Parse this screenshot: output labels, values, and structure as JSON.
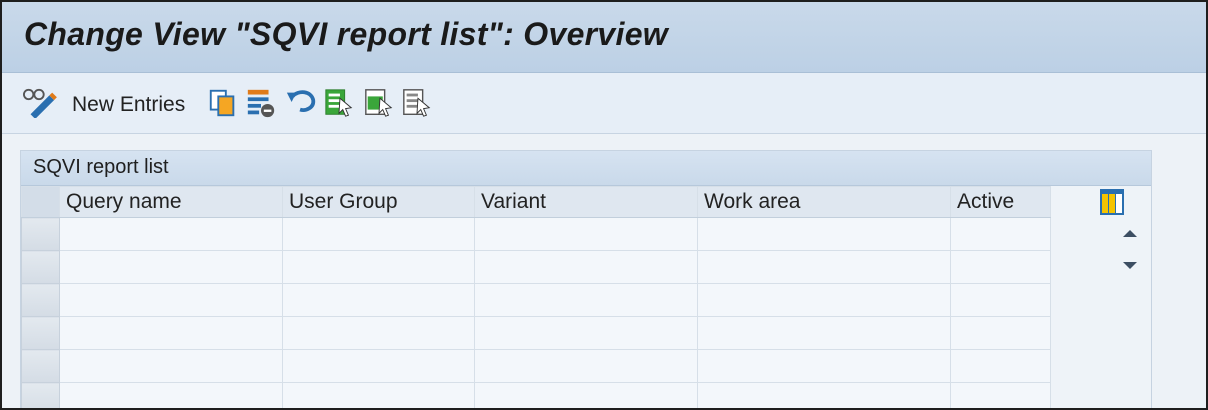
{
  "window": {
    "title": "Change View \"SQVI report list\": Overview"
  },
  "toolbar": {
    "new_entries_label": "New Entries",
    "icons": [
      "display-change-icon",
      "copy-icon",
      "delete-icon",
      "undo-icon",
      "select-all-icon",
      "select-block-icon",
      "deselect-all-icon"
    ]
  },
  "table": {
    "title": "SQVI report list",
    "columns": [
      "Query name",
      "User Group",
      "Variant",
      "Work area",
      "Active"
    ],
    "rows": [
      [
        "",
        "",
        "",
        "",
        ""
      ],
      [
        "",
        "",
        "",
        "",
        ""
      ],
      [
        "",
        "",
        "",
        "",
        ""
      ],
      [
        "",
        "",
        "",
        "",
        ""
      ],
      [
        "",
        "",
        "",
        "",
        ""
      ],
      [
        "",
        "",
        "",
        "",
        ""
      ]
    ]
  },
  "colors": {
    "title_bar": "#c9d9ea",
    "toolbar_bg": "#e6eef7",
    "grid_cell": "#f3f7fb",
    "icon_green": "#3aa63a",
    "icon_orange": "#e07b1a",
    "icon_blue": "#2a6fb0"
  }
}
